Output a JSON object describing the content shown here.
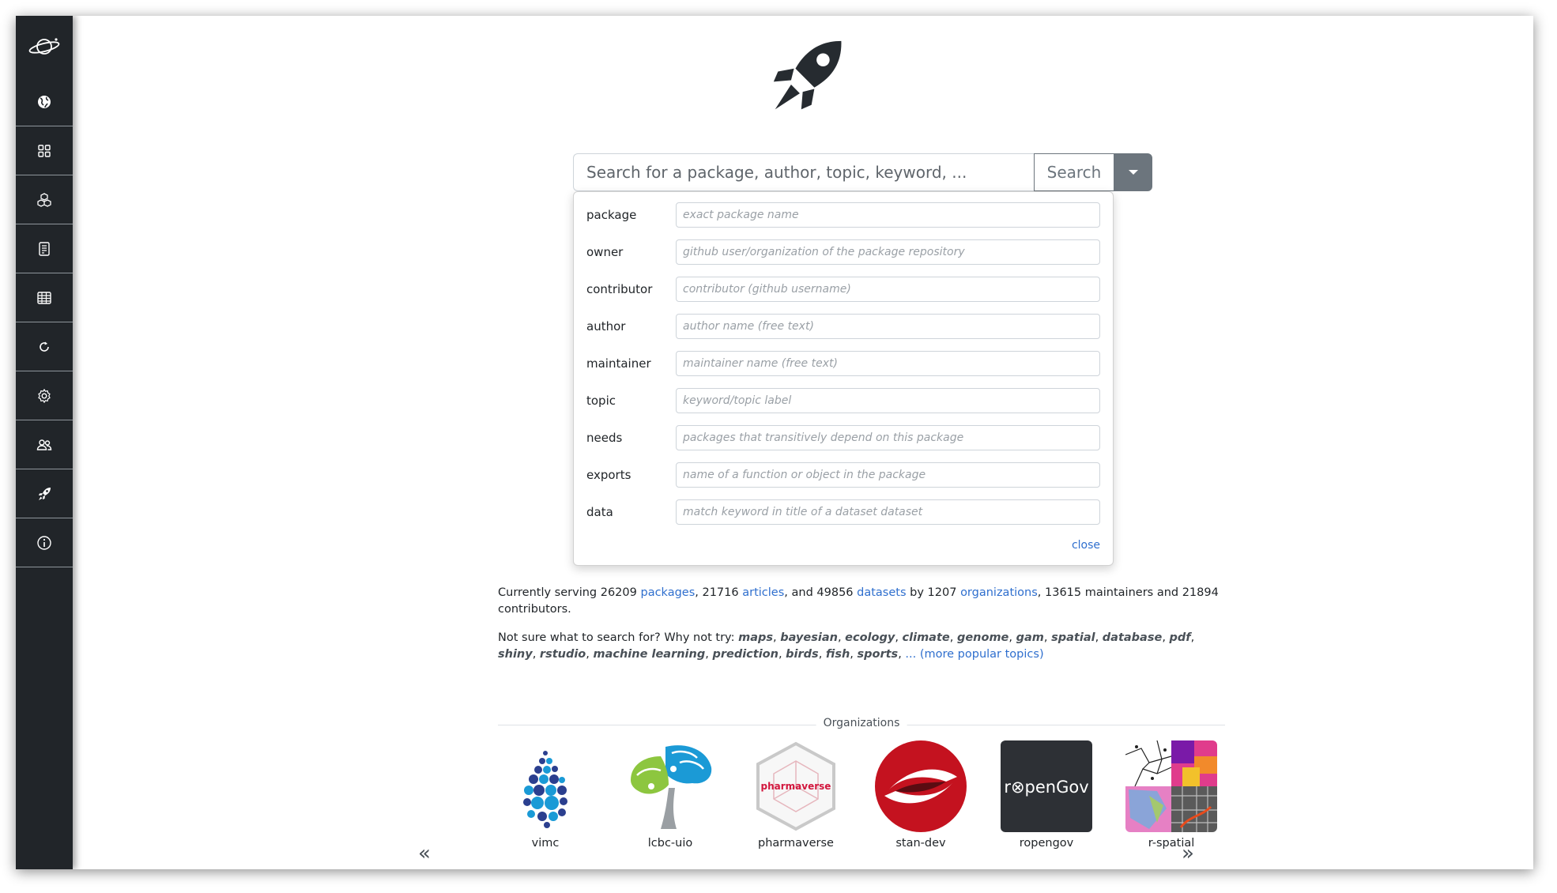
{
  "sidebar": {
    "items": [
      {
        "icon": "globe-icon",
        "label": "universes"
      },
      {
        "icon": "grid-icon",
        "label": "packages"
      },
      {
        "icon": "cubes-icon",
        "label": "apis"
      },
      {
        "icon": "document-icon",
        "label": "articles"
      },
      {
        "icon": "table-icon",
        "label": "datasets"
      },
      {
        "icon": "refresh-icon",
        "label": "builds"
      },
      {
        "icon": "gear-icon",
        "label": "settings"
      },
      {
        "icon": "people-icon",
        "label": "contributors"
      },
      {
        "icon": "rocket-icon",
        "label": "search"
      },
      {
        "icon": "info-icon",
        "label": "about"
      }
    ]
  },
  "search": {
    "placeholder": "Search for a package, author, topic, keyword, ...",
    "button_label": "Search"
  },
  "advanced": {
    "fields": [
      {
        "label": "package",
        "placeholder": "exact package name"
      },
      {
        "label": "owner",
        "placeholder": "github user/organization of the package repository"
      },
      {
        "label": "contributor",
        "placeholder": "contributor (github username)"
      },
      {
        "label": "author",
        "placeholder": "author name (free text)"
      },
      {
        "label": "maintainer",
        "placeholder": "maintainer name (free text)"
      },
      {
        "label": "topic",
        "placeholder": "keyword/topic label"
      },
      {
        "label": "needs",
        "placeholder": "packages that transitively depend on this package"
      },
      {
        "label": "exports",
        "placeholder": "name of a function or object in the package"
      },
      {
        "label": "data",
        "placeholder": "match keyword in title of a dataset dataset"
      }
    ],
    "close_label": "close"
  },
  "stats": {
    "prefix": "Currently serving",
    "packages_count": "26209",
    "packages_link": "packages",
    "articles_count": "21716",
    "articles_link": "articles",
    "datasets_count": "49856",
    "datasets_link": "datasets",
    "orgs_count": "1207",
    "orgs_link": "organizations",
    "maintainers_count": "13615",
    "contributors_count": "21894"
  },
  "topics": {
    "intro": "Not sure what to search for? Why not try:",
    "items": [
      "maps",
      "bayesian",
      "ecology",
      "climate",
      "genome",
      "gam",
      "spatial",
      "database",
      "pdf",
      "shiny",
      "rstudio",
      "machine learning",
      "prediction",
      "birds",
      "fish",
      "sports"
    ],
    "more_ellipsis": "...",
    "more_label": "(more popular topics)"
  },
  "organizations": {
    "heading": "Organizations",
    "items": [
      {
        "name": "vimc"
      },
      {
        "name": "lcbc-uio"
      },
      {
        "name": "pharmaverse",
        "logo_text": "pharmaverse"
      },
      {
        "name": "stan-dev"
      },
      {
        "name": "ropengov",
        "logo_text": "r⊗penGov"
      },
      {
        "name": "r-spatial"
      }
    ],
    "prev_label": "«",
    "next_label": "»"
  },
  "colors": {
    "sidebar_bg": "#212529",
    "link": "#2f6fce",
    "secondary": "#6c757d",
    "stan_red": "#c4121f",
    "ropengov_bg": "#2d3035",
    "ropengov_accent": "#e8771c"
  }
}
